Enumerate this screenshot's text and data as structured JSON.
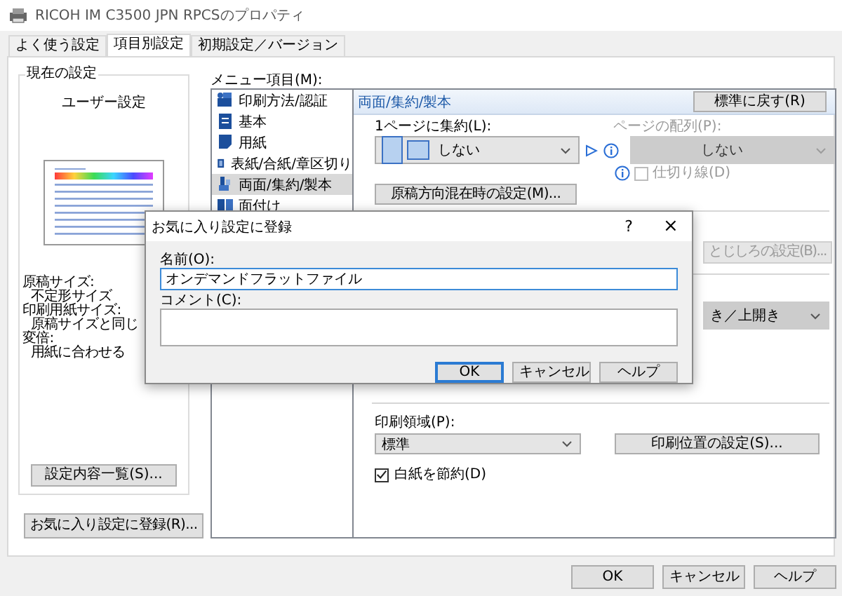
{
  "window": {
    "title": "RICOH IM C3500 JPN RPCSのプロパティ"
  },
  "tabs": [
    {
      "label": "よく使う設定",
      "selected": false
    },
    {
      "label": "項目別設定",
      "selected": true
    },
    {
      "label": "初期設定／バージョン",
      "selected": false
    }
  ],
  "current_settings": {
    "title": "現在の設定",
    "profile": "ユーザー設定",
    "details": [
      {
        "label": "原稿サイズ:",
        "value": "不定形サイズ"
      },
      {
        "label": "印刷用紙サイズ:",
        "value": "原稿サイズと同じ"
      },
      {
        "label": "変倍:",
        "value": "用紙に合わせる"
      }
    ],
    "summary_button": "設定内容一覧(S)..."
  },
  "favorite_button": "お気に入り設定に登録(R)...",
  "menu": {
    "label": "メニュー項目(M):",
    "items": [
      {
        "label": "印刷方法/認証",
        "selected": false
      },
      {
        "label": "基本",
        "selected": false
      },
      {
        "label": "用紙",
        "selected": false
      },
      {
        "label": "表紙/合紙/章区切り",
        "selected": false
      },
      {
        "label": "両面/集約/製本",
        "selected": true
      },
      {
        "label": "面付け",
        "selected": false
      }
    ]
  },
  "panel": {
    "title": "両面/集約/製本",
    "reset_button": "標準に戻す(R)",
    "layout": {
      "label": "1ページに集約(L):",
      "value": "しない"
    },
    "page_order": {
      "label": "ページの配列(P):",
      "value": "しない",
      "disabled": true
    },
    "separator_line": {
      "label": "仕切り線(D)",
      "checked": false,
      "disabled": true
    },
    "orientation_button": "原稿方向混在時の設定(M)...",
    "binding_button": {
      "label": "とじしろの設定(B)...",
      "disabled": true
    },
    "opening": {
      "value": "き／上開き"
    },
    "print_area": {
      "label": "印刷領域(P):",
      "value": "標準"
    },
    "print_position_button": "印刷位置の設定(S)...",
    "save_blank": {
      "label": "白紙を節約(D)",
      "checked": true
    }
  },
  "buttons": [
    {
      "label": "OK"
    },
    {
      "label": "キャンセル"
    },
    {
      "label": "ヘルプ"
    }
  ],
  "dialog": {
    "title": "お気に入り設定に登録",
    "help": "?",
    "close": "×",
    "name_label": "名前(O):",
    "name_value": "オンデマンドフラットファイル",
    "comment_label": "コメント(C):",
    "buttons": [
      {
        "label": "OK",
        "focused": true
      },
      {
        "label": "キャンセル",
        "focused": false
      },
      {
        "label": "ヘルプ",
        "focused": false
      }
    ]
  }
}
